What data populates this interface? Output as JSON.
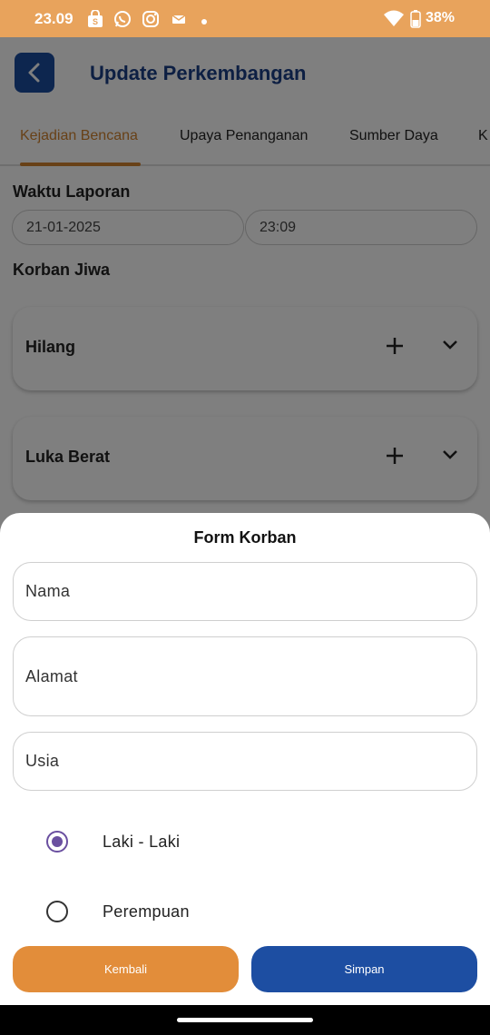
{
  "status_bar": {
    "time": "23.09",
    "battery": "38%",
    "icons": [
      "shopping-bag-icon",
      "whatsapp-icon",
      "instagram-icon",
      "mail-icon",
      "dot-icon",
      "wifi-icon",
      "battery-icon"
    ]
  },
  "header": {
    "title": "Update Perkembangan"
  },
  "tabs": [
    {
      "label": "Kejadian Bencana",
      "active": true
    },
    {
      "label": "Upaya Penanganan"
    },
    {
      "label": "Sumber Daya"
    },
    {
      "label": "K"
    }
  ],
  "report_time": {
    "label": "Waktu Laporan",
    "date": "21-01-2025",
    "time": "23:09"
  },
  "victims": {
    "label": "Korban Jiwa",
    "categories": [
      {
        "title": "Hilang"
      },
      {
        "title": "Luka Berat"
      }
    ]
  },
  "form": {
    "title": "Form Korban",
    "name_placeholder": "Nama",
    "address_placeholder": "Alamat",
    "age_placeholder": "Usia",
    "gender_options": [
      {
        "label": "Laki - Laki",
        "selected": true
      },
      {
        "label": "Perempuan",
        "selected": false
      }
    ],
    "back_label": "Kembali",
    "save_label": "Simpan"
  },
  "colors": {
    "status_bar": "#E8A35C",
    "primary_blue": "#1D4EA2",
    "accent_orange": "#E28D3A",
    "radio_purple": "#6A4FA0"
  }
}
